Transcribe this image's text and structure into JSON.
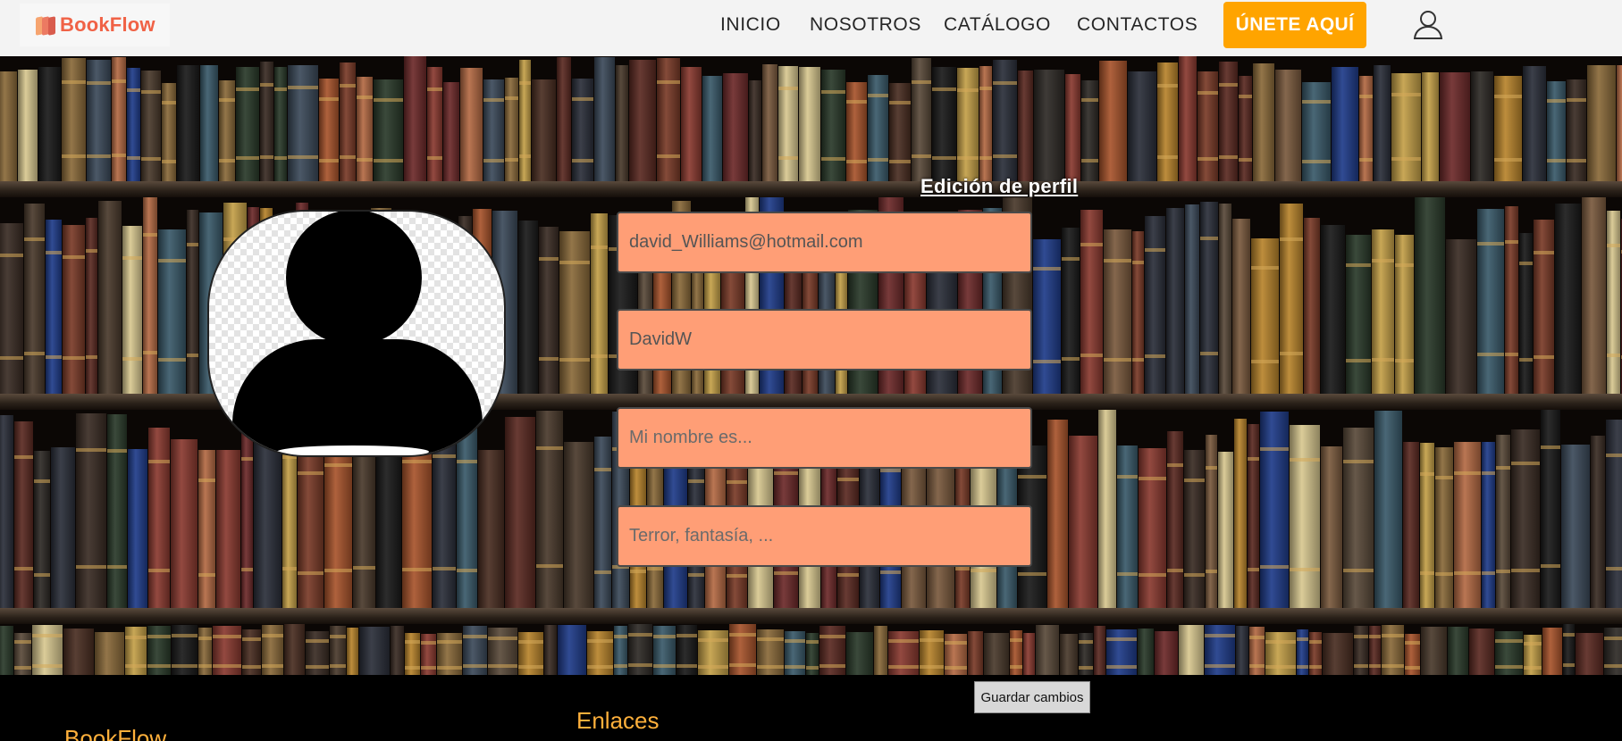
{
  "brand": {
    "name": "BookFlow",
    "accent": "#f06246"
  },
  "nav": {
    "items": [
      {
        "label": "INICIO"
      },
      {
        "label": "NOSOTROS"
      },
      {
        "label": "CATÁLOGO"
      },
      {
        "label": "CONTACTOS"
      }
    ],
    "cta_label": "ÚNETE AQUÍ",
    "cta_color": "#ffa400",
    "user_icon": "user-icon"
  },
  "profile": {
    "title": "Edición de perfil",
    "avatar_icon": "avatar-placeholder-icon",
    "email_value": "david_Williams@hotmail.com",
    "username_value": "DavidW",
    "name_placeholder": "Mi nombre es...",
    "genres_placeholder": "Terror, fantasía, ...",
    "field_color": "#ff9e76",
    "save_label": "Guardar cambios"
  },
  "footer": {
    "brand": "BookFlow",
    "links_title": "Enlaces",
    "heading_color": "#ffb03b"
  }
}
